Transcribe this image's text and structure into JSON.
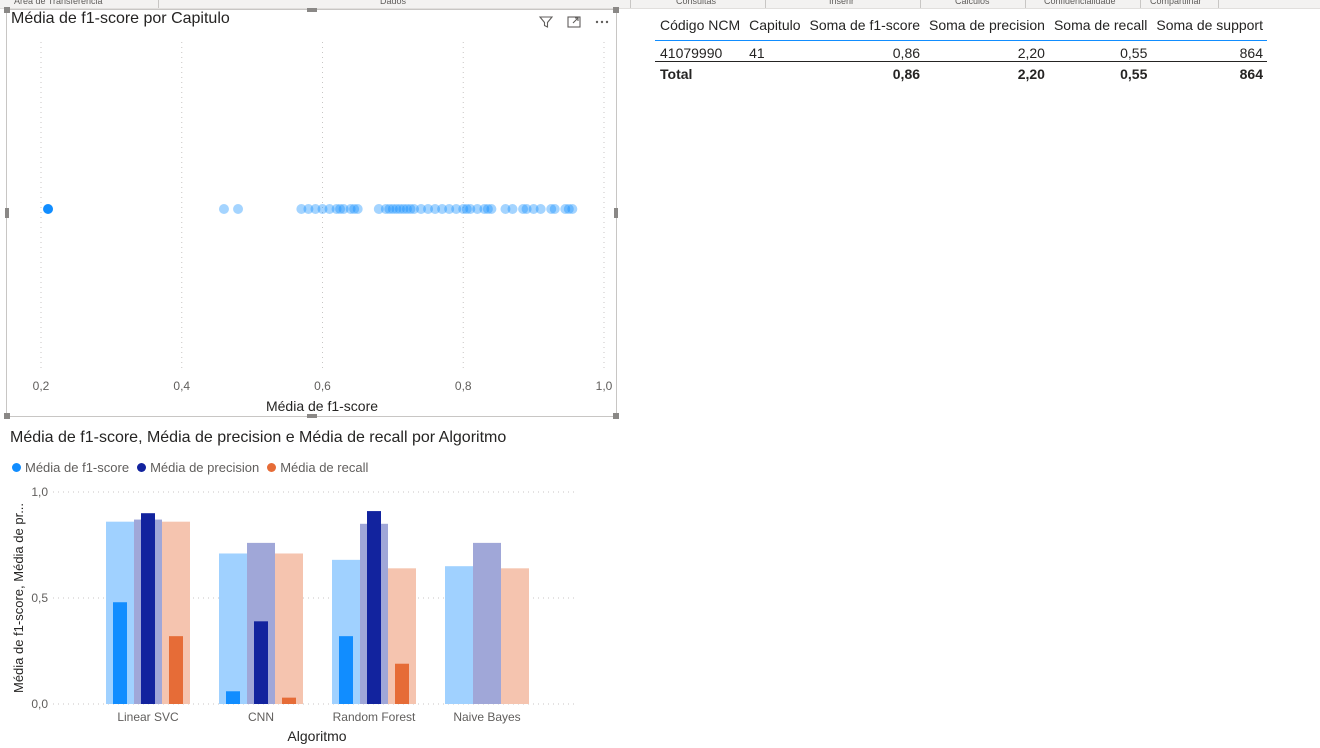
{
  "ribbon": {
    "groups": [
      "Área de Transferência",
      "Dados",
      "Consultas",
      "Inserir",
      "Cálculos",
      "Confidencialidade",
      "Compartilhar"
    ]
  },
  "scatter": {
    "title": "Média de f1-score por Capitulo",
    "header_icons": [
      "filter-icon",
      "focus-mode-icon",
      "more-options-icon"
    ]
  },
  "table": {
    "headers": [
      "Código NCM",
      "Capitulo",
      "Soma de f1-score",
      "Soma de precision",
      "Soma de recall",
      "Soma de support"
    ],
    "rows": [
      [
        "41079990",
        "41",
        "0,86",
        "2,20",
        "0,55",
        "864"
      ]
    ],
    "total": [
      "Total",
      "",
      "0,86",
      "2,20",
      "0,55",
      "864"
    ]
  },
  "bars": {
    "title": "Média de f1-score, Média de precision e Média de recall por Algoritmo"
  },
  "colors": {
    "f1": "#118dff",
    "precision": "#12239e",
    "recall": "#e66c37",
    "f1_light": "#a0d1ff",
    "precision_light": "#a0a7d8",
    "recall_light": "#f5c4af",
    "gridline": "#c8c6c4",
    "text_secondary": "#605e5c"
  },
  "chart_data": [
    {
      "type": "scatter",
      "title": "Média de f1-score por Capitulo",
      "xlabel": "Média de f1-score",
      "ylabel": "",
      "xlim": [
        0.18,
        1.0
      ],
      "x_ticks": [
        "0,2",
        "0,4",
        "0,6",
        "0,8",
        "1,0"
      ],
      "x_tick_values": [
        0.2,
        0.4,
        0.6,
        0.8,
        1.0
      ],
      "highlighted": [
        0.21
      ],
      "x": [
        0.46,
        0.48,
        0.57,
        0.58,
        0.59,
        0.6,
        0.61,
        0.62,
        0.625,
        0.63,
        0.64,
        0.645,
        0.65,
        0.68,
        0.69,
        0.695,
        0.7,
        0.705,
        0.71,
        0.715,
        0.72,
        0.725,
        0.73,
        0.74,
        0.75,
        0.76,
        0.77,
        0.78,
        0.79,
        0.8,
        0.805,
        0.81,
        0.82,
        0.83,
        0.835,
        0.84,
        0.86,
        0.87,
        0.885,
        0.89,
        0.9,
        0.91,
        0.925,
        0.93,
        0.945,
        0.95,
        0.955
      ],
      "grid": true
    },
    {
      "type": "bar",
      "title": "Média de f1-score, Média de precision e Média de recall por Algoritmo",
      "xlabel": "Algoritmo",
      "ylabel": "Média de f1-score, Média de pr...",
      "categories": [
        "Linear SVC",
        "CNN",
        "Random Forest",
        "Naive Bayes"
      ],
      "ylim": [
        0,
        1
      ],
      "y_ticks": [
        "0,0",
        "0,5",
        "1,0"
      ],
      "y_tick_values": [
        0,
        0.5,
        1.0
      ],
      "legend_position": "top-left",
      "series": [
        {
          "name": "Média de f1-score",
          "values": [
            0.86,
            0.71,
            0.68,
            0.65
          ],
          "highlighted": [
            0.48,
            0.06,
            0.32,
            null
          ]
        },
        {
          "name": "Média de precision",
          "values": [
            0.87,
            0.76,
            0.85,
            0.76
          ],
          "highlighted": [
            0.9,
            0.39,
            0.91,
            null
          ]
        },
        {
          "name": "Média de recall",
          "values": [
            0.86,
            0.71,
            0.64,
            0.64
          ],
          "highlighted": [
            0.32,
            0.03,
            0.19,
            null
          ]
        }
      ]
    }
  ]
}
